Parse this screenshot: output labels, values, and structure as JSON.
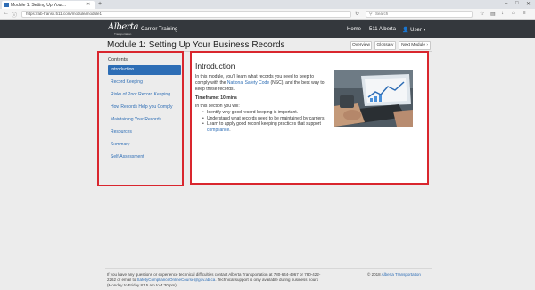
{
  "browser": {
    "tab_title": "Module 1: Setting Up Your...",
    "url": "https://ab-transit.511.com/module/module1",
    "search_placeholder": "Search"
  },
  "header": {
    "logo_text": "Alberta",
    "logo_sub": "Transportation",
    "site_name": "Carrier Training",
    "nav": {
      "home": "Home",
      "alberta": "511 Alberta",
      "user": "User ▾"
    }
  },
  "page": {
    "title": "Module 1: Setting Up Your Business Records",
    "buttons": {
      "overview": "Overview",
      "glossary": "Glossary",
      "next": "Next Module ›"
    }
  },
  "contents": {
    "heading": "Contents",
    "items": [
      "Introduction",
      "Record Keeping",
      "Risks of Poor Record Keeping",
      "How Records Help you Comply",
      "Maintaining Your Records",
      "Resources",
      "Summary",
      "Self-Assessment"
    ]
  },
  "intro": {
    "heading": "Introduction",
    "para_before": "In this module, you'll learn what records you need to keep to comply with the ",
    "para_link": "National Safety Code",
    "para_after": " (NSC), and the best way to keep these records.",
    "timeframe": "Timeframe: 10 mins",
    "section_intro": "In this section you will:",
    "bullet1": "Identify why good record keeping is important.",
    "bullet2": "Understand what records need to be maintained by carriers.",
    "bullet3_before": "Learn to apply good record keeping practices that support ",
    "bullet3_link": "compliance",
    "bullet3_after": "."
  },
  "footer": {
    "text_before": "If you have any questions or experience technical difficulties contact Alberta Transportation at 780-644-4967 or 780-422-2262 or email to ",
    "email": "SafetyComplianceOnlineCourse@gov.ab.ca",
    "text_after": ". Technical support is only available during business hours (Monday to Friday 8:15 am to 4:30 pm).",
    "copyright_before": "© 2018 ",
    "copyright_link": "Alberta Transportation"
  }
}
